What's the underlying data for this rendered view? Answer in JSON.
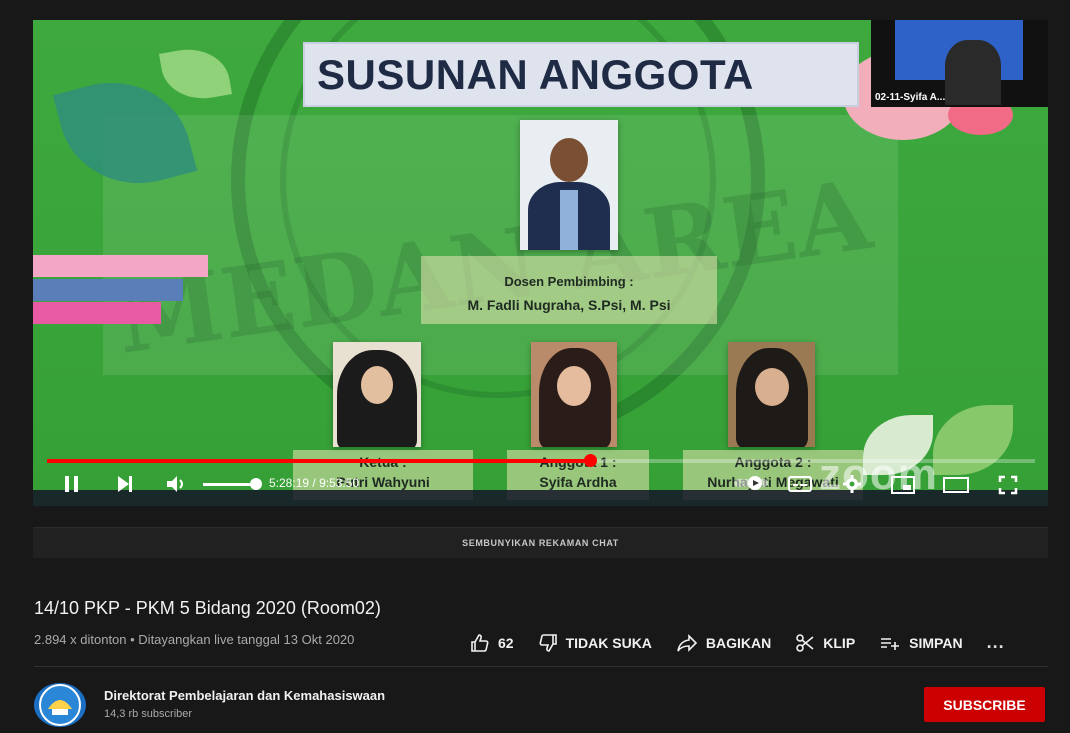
{
  "player": {
    "slide": {
      "title": "SUSUNAN ANGGOTA",
      "advisor_role": "Dosen Pembimbing :",
      "advisor_name": "M. Fadli Nugraha, S.Psi, M. Psi",
      "members": [
        {
          "role": "Ketua :",
          "name": "Putri Wahyuni"
        },
        {
          "role": "Anggota 1 :",
          "name": "Syifa Ardha"
        },
        {
          "role": "Anggota 2 :",
          "name": "Nurhayati Megawati"
        }
      ],
      "watermark": "MEDAN AREA"
    },
    "participant_camera_name": "02-11-Syifa A...",
    "zoom_logo": "zoom",
    "progress_fraction": 0.55,
    "volume_fraction": 0.95,
    "time_current": "5:28:19",
    "time_total": "9:53:50",
    "time_separator": " / ",
    "icons": [
      "pause-icon",
      "next-icon",
      "volume-icon",
      "autoplay-toggle-icon",
      "subtitles-icon",
      "settings-icon",
      "miniplayer-icon",
      "theater-icon",
      "fullscreen-icon"
    ]
  },
  "chat": {
    "hide_label": "SEMBUNYIKAN REKAMAN CHAT"
  },
  "video": {
    "title": "14/10 PKP - PKM 5 Bidang 2020 (Room02)",
    "meta": "2.894 x ditonton • Ditayangkan live tanggal 13 Okt 2020"
  },
  "actions": {
    "like_count": "62",
    "dislike": "TIDAK SUKA",
    "share": "BAGIKAN",
    "clip": "KLIP",
    "save": "SIMPAN",
    "more": "..."
  },
  "channel": {
    "name": "Direktorat Pembelajaran dan Kemahasiswaan",
    "subscribers": "14,3 rb subscriber",
    "subscribe_label": "SUBSCRIBE"
  },
  "colors": {
    "slide_green": "#3aa63b",
    "progress_red": "#ff0000",
    "subscribe_red": "#cc0000",
    "background": "#181818"
  }
}
